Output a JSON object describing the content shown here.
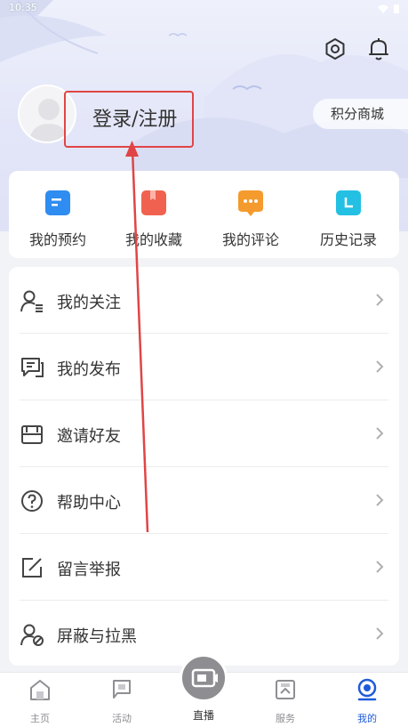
{
  "status_bar": {
    "time": "10:35"
  },
  "header": {
    "login_label": "登录/注册",
    "points_mall_label": "积分商城"
  },
  "quick_actions": [
    {
      "label": "我的预约",
      "icon": "reservation-icon",
      "color": "#2f8cf0"
    },
    {
      "label": "我的收藏",
      "icon": "favorites-icon",
      "color": "#f0624f"
    },
    {
      "label": "我的评论",
      "icon": "comments-icon",
      "color": "#f59a2c"
    },
    {
      "label": "历史记录",
      "icon": "history-icon",
      "color": "#23c0e3"
    }
  ],
  "menu": [
    {
      "label": "我的关注",
      "icon": "follow-user-icon"
    },
    {
      "label": "我的发布",
      "icon": "publish-icon"
    },
    {
      "label": "邀请好友",
      "icon": "invite-envelope-icon"
    },
    {
      "label": "帮助中心",
      "icon": "help-icon"
    },
    {
      "label": "留言举报",
      "icon": "report-edit-icon"
    },
    {
      "label": "屏蔽与拉黑",
      "icon": "block-user-icon"
    }
  ],
  "tabbar": {
    "tabs": [
      {
        "label": "主页",
        "icon": "home-icon"
      },
      {
        "label": "活动",
        "icon": "flag-icon"
      },
      {
        "label": "直播",
        "icon": "live-video-icon"
      },
      {
        "label": "服务",
        "icon": "service-icon"
      },
      {
        "label": "我的",
        "icon": "profile-icon",
        "active": true
      }
    ]
  },
  "colors": {
    "accent": "#1f5bd9",
    "annotation_red": "#e04545",
    "tab_inactive": "#8e8e93"
  }
}
